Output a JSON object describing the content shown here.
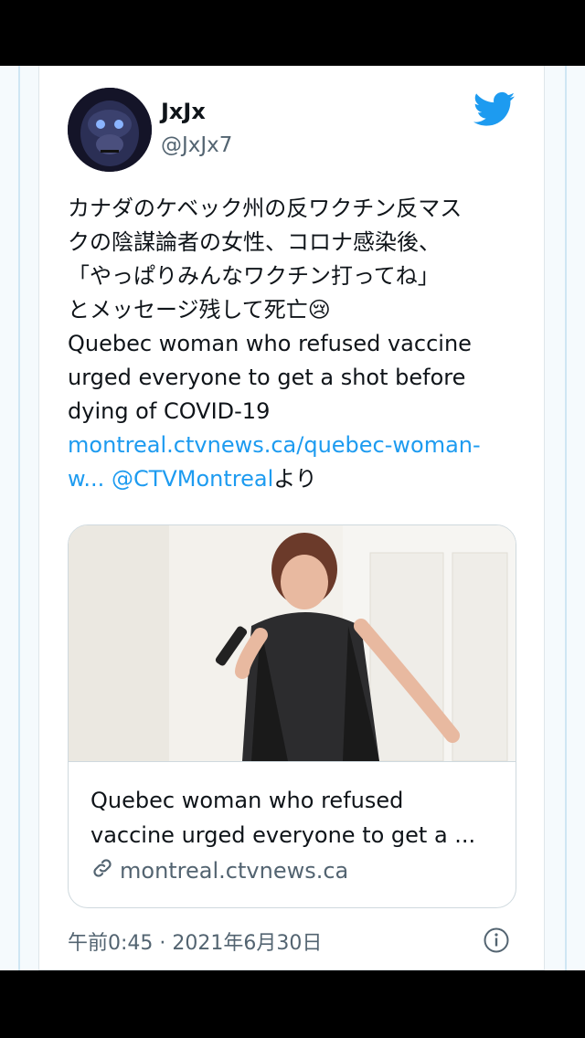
{
  "tweet": {
    "display_name": "JxJx",
    "handle": "@JxJx7",
    "text_lines": [
      "カナダのケベック州の反ワクチン反マス",
      "クの陰謀論者の女性、コロナ感染後、",
      "「やっぱりみんなワクチン打ってね」",
      "とメッセージ残して死亡😢",
      "Quebec woman who refused vaccine",
      "urged everyone to get a shot before",
      "dying of COVID-19"
    ],
    "link_line1": "montreal.ctvnews.ca/quebec-woman-",
    "link_line2": "w...",
    "mention": "@CTVMontreal",
    "mention_suffix": "より",
    "timestamp": "午前0:45 · 2021年6月30日"
  },
  "preview": {
    "title_line1": "Quebec woman who refused",
    "title_line2": "vaccine urged everyone to get a ...",
    "domain": "montreal.ctvnews.ca",
    "image_desc_icon": "photo"
  },
  "icons": {
    "brand": "twitter-bird-icon",
    "link": "link-icon",
    "info": "info-icon"
  },
  "colors": {
    "accent": "#1d9bf0",
    "text": "#0f1419",
    "muted": "#536471"
  }
}
